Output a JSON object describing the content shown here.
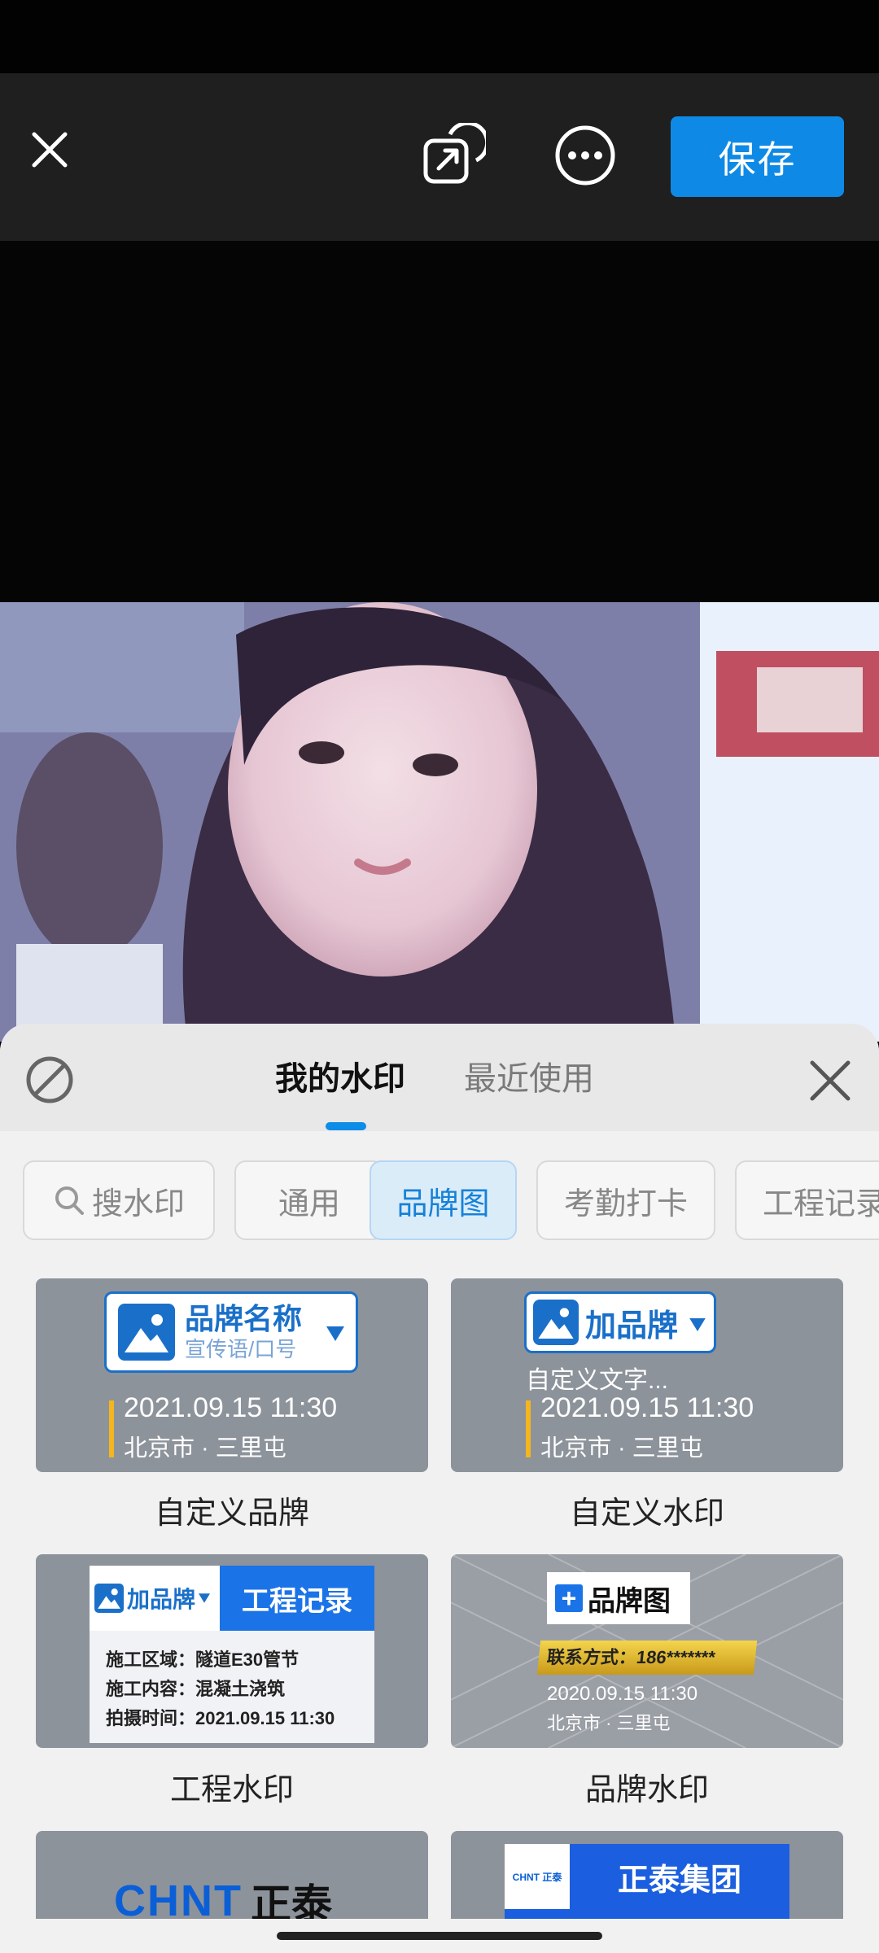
{
  "toolbar": {
    "close_icon": "close-icon",
    "share_icon": "share-icon",
    "more_icon": "more-icon",
    "save_label": "保存",
    "accent": "#0e8ae6"
  },
  "sheet": {
    "tabs": [
      {
        "label": "我的水印",
        "active": true
      },
      {
        "label": "最近使用",
        "active": false
      }
    ],
    "chips": [
      {
        "label": "搜水印",
        "icon": "search-icon"
      },
      {
        "label": "通用"
      },
      {
        "label": "品牌图",
        "active": true
      },
      {
        "label": "考勤打卡"
      },
      {
        "label": "工程记录"
      }
    ],
    "cards": [
      {
        "label": "自定义品牌",
        "brand_name": "品牌名称",
        "slogan": "宣传语/口号",
        "date": "2021.09.15  11:30",
        "location": "北京市 · 三里屯"
      },
      {
        "label": "自定义水印",
        "brand_name": "加品牌",
        "custom_text": "自定义文字...",
        "date": "2021.09.15  11:30",
        "location": "北京市 · 三里屯"
      },
      {
        "label": "工程水印",
        "brand_name": "加品牌",
        "title": "工程记录",
        "lines": [
          "施工区域：隧道E30管节",
          "施工内容：混凝土浇筑",
          "拍摄时间：2021.09.15 11:30"
        ]
      },
      {
        "label": "品牌水印",
        "brand_name": "品牌图",
        "contact": "联系方式：186*******",
        "date": "2020.09.15  11:30",
        "location": "北京市 · 三里屯"
      },
      {
        "logo_text": "CHNT",
        "logo_cn": "正泰"
      },
      {
        "mini_logo": "CHNT 正泰",
        "group_name": "正泰集团"
      }
    ]
  }
}
